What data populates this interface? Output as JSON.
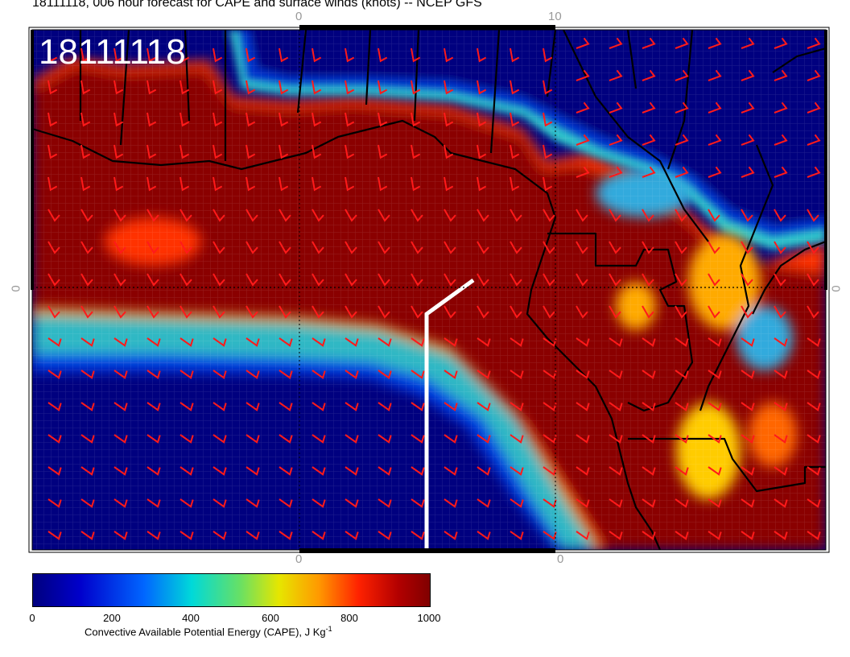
{
  "title": "18111118, 006 hour forecast for CAPE and surface winds (knots) -- NCEP GFS",
  "stamp": "18111118",
  "axis_labels": {
    "top_left": "0",
    "top_right": "10",
    "left": "0",
    "right": "0",
    "bottom_left": "0",
    "bottom_right": "0"
  },
  "colorbar": {
    "ticks": [
      "0",
      "200",
      "400",
      "600",
      "800",
      "1000"
    ],
    "label": "Convective Available Potential Energy (CAPE), J Kg",
    "label_sup": "-1"
  },
  "colors": {
    "low_cape": "#00007f",
    "high_cape": "#800000",
    "wind_barbs": "#ff1a1a",
    "coastline": "#000000",
    "cross_section": "#ffffff"
  }
}
